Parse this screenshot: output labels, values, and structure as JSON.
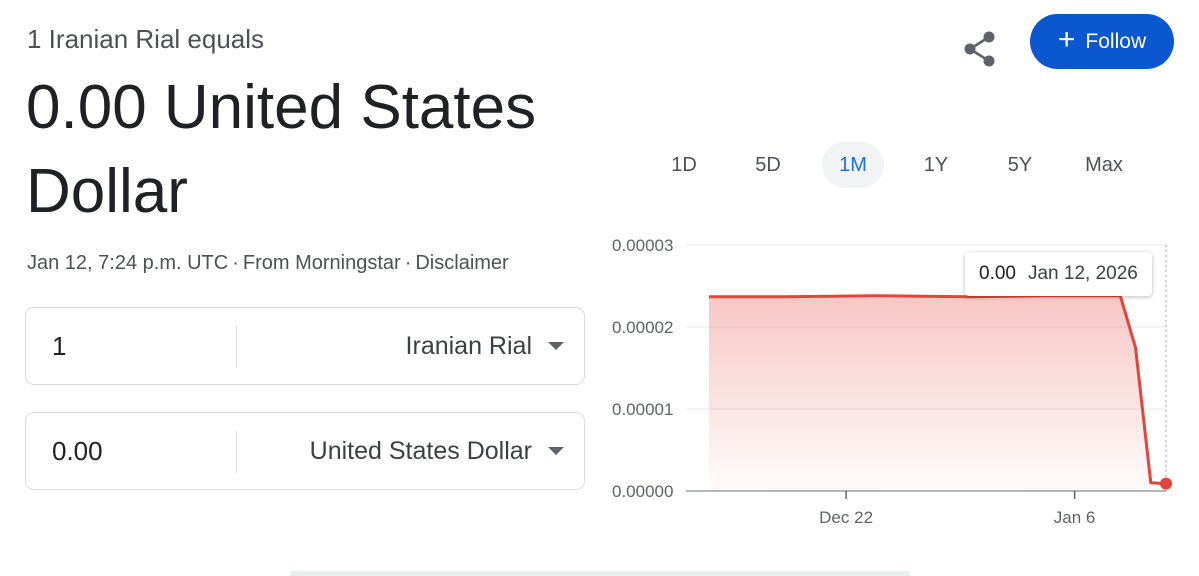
{
  "header": {
    "subtitle": "1 Iranian Rial equals",
    "result_line1": "0.00 United States",
    "result_line2": "Dollar",
    "timestamp": "Jan 12, 7:24 p.m. UTC",
    "separator": "·",
    "source": "From Morningstar",
    "disclaimer": "Disclaimer"
  },
  "actions": {
    "share_icon": "share-icon",
    "follow_label": "Follow",
    "follow_icon": "+",
    "follow_color": "#0b57d0"
  },
  "converter": {
    "from": {
      "amount": "1",
      "currency": "Iranian Rial"
    },
    "to": {
      "amount": "0.00",
      "currency": "United States Dollar"
    }
  },
  "ranges": [
    {
      "label": "1D",
      "active": false
    },
    {
      "label": "5D",
      "active": false
    },
    {
      "label": "1M",
      "active": true
    },
    {
      "label": "1Y",
      "active": false
    },
    {
      "label": "5Y",
      "active": false
    },
    {
      "label": "Max",
      "active": false
    }
  ],
  "tooltip": {
    "value": "0.00",
    "date": "Jan 12, 2026"
  },
  "chart_data": {
    "type": "area",
    "title": "",
    "xlabel": "",
    "ylabel": "",
    "y_ticks": [
      "0.00003",
      "0.00002",
      "0.00001",
      "0.00000"
    ],
    "y_tick_values": [
      3e-05,
      2e-05,
      1e-05,
      0.0
    ],
    "ylim": [
      0,
      3e-05
    ],
    "x_ticks": [
      {
        "label": "Dec 22",
        "day": 22
      },
      {
        "label": "Jan 6",
        "day": 37
      }
    ],
    "xlim": [
      13,
      43
    ],
    "series": [
      {
        "x": [
          13,
          18,
          24,
          30,
          35,
          40,
          41,
          42,
          43
        ],
        "values": [
          2.37e-05,
          2.37e-05,
          2.38e-05,
          2.37e-05,
          2.38e-05,
          2.38e-05,
          1.75e-05,
          1e-06,
          9e-07
        ],
        "color": "#e2453c"
      }
    ],
    "grid": true,
    "highlight_last_point": true
  }
}
